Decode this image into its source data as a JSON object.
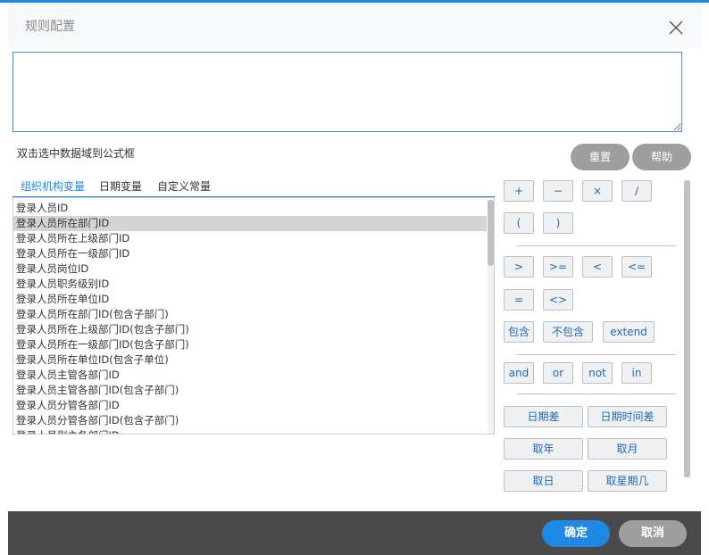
{
  "dialog": {
    "title": "规则配置",
    "formula_value": "",
    "hint": "双击选中数据域到公式框",
    "reset_label": "重置",
    "help_label": "帮助"
  },
  "tabs": [
    {
      "label": "组织机构变量",
      "active": true
    },
    {
      "label": "日期变量",
      "active": false
    },
    {
      "label": "自定义常量",
      "active": false
    }
  ],
  "variables": [
    {
      "label": "登录人员ID",
      "selected": false
    },
    {
      "label": "登录人员所在部门ID",
      "selected": true
    },
    {
      "label": "登录人员所在上级部门ID",
      "selected": false
    },
    {
      "label": "登录人员所在一级部门ID",
      "selected": false
    },
    {
      "label": "登录人员岗位ID",
      "selected": false
    },
    {
      "label": "登录人员职务级别ID",
      "selected": false
    },
    {
      "label": "登录人员所在单位ID",
      "selected": false
    },
    {
      "label": "登录人员所在部门ID(包含子部门)",
      "selected": false
    },
    {
      "label": "登录人员所在上级部门ID(包含子部门)",
      "selected": false
    },
    {
      "label": "登录人员所在一级部门ID(包含子部门)",
      "selected": false
    },
    {
      "label": "登录人员所在单位ID(包含子单位)",
      "selected": false
    },
    {
      "label": "登录人员主管各部门ID",
      "selected": false
    },
    {
      "label": "登录人员主管各部门ID(包含子部门)",
      "selected": false
    },
    {
      "label": "登录人员分管各部门ID",
      "selected": false
    },
    {
      "label": "登录人员分管各部门ID(包含子部门)",
      "selected": false
    },
    {
      "label": "登录人员副主各部门ID",
      "selected": false
    }
  ],
  "operators": {
    "plus": "+",
    "minus": "−",
    "multiply": "×",
    "divide": "∕",
    "lparen": "(",
    "rparen": ")",
    "gt": ">",
    "gte": ">=",
    "lt": "<",
    "lte": "<=",
    "eq": "=",
    "neq": "<>",
    "contains": "包含",
    "not_contains": "不包含",
    "extend": "extend",
    "and": "and",
    "or": "or",
    "not": "not",
    "in": "in",
    "date_diff": "日期差",
    "datetime_diff": "日期时间差",
    "get_year": "取年",
    "get_month": "取月",
    "get_day": "取日",
    "get_weekday": "取星期几"
  },
  "footer": {
    "confirm_label": "确定",
    "cancel_label": "取消"
  },
  "colors": {
    "accent": "#1e88e5",
    "confirm_bg": "#1e88e5",
    "cancel_bg": "#9e9e9e",
    "footer_bg": "#4a4a4a",
    "operator_text": "#1e6bb8"
  }
}
